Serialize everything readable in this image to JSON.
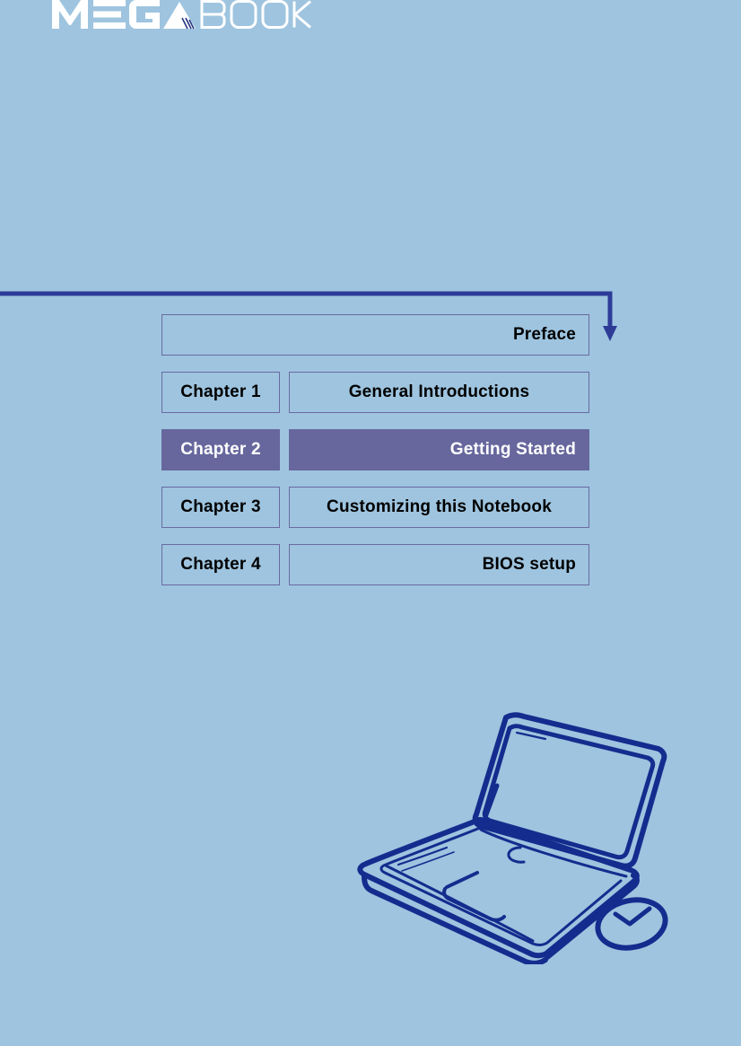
{
  "brand": {
    "logo_text": "MEGABOOK",
    "logo_part_solid": "MEGA",
    "logo_part_outline": "BOOK"
  },
  "colors": {
    "header_navy": "#24357F",
    "page_blue": "#9EC4DF",
    "highlight_purple": "#67679E",
    "box_border": "#6A6AA0",
    "arrow_navy": "#2E3C98",
    "sketch_navy": "#142C8E",
    "text_dark": "#000000",
    "text_light": "#FFFFFF"
  },
  "toc": {
    "rows": [
      {
        "chapter": "",
        "title": "Preface",
        "align": "right",
        "highlighted": false,
        "full_width": true
      },
      {
        "chapter": "Chapter  1",
        "title": "General Introductions",
        "align": "center",
        "highlighted": false,
        "full_width": false
      },
      {
        "chapter": "Chapter  2",
        "title": "Getting Started",
        "align": "right",
        "highlighted": true,
        "full_width": false
      },
      {
        "chapter": "Chapter  3",
        "title": "Customizing this Notebook",
        "align": "center",
        "highlighted": false,
        "full_width": false
      },
      {
        "chapter": "Chapter  4",
        "title": "BIOS setup",
        "align": "right",
        "highlighted": false,
        "full_width": false
      }
    ]
  },
  "illustration": {
    "name": "notebook-laptop-and-mouse-sketch"
  }
}
